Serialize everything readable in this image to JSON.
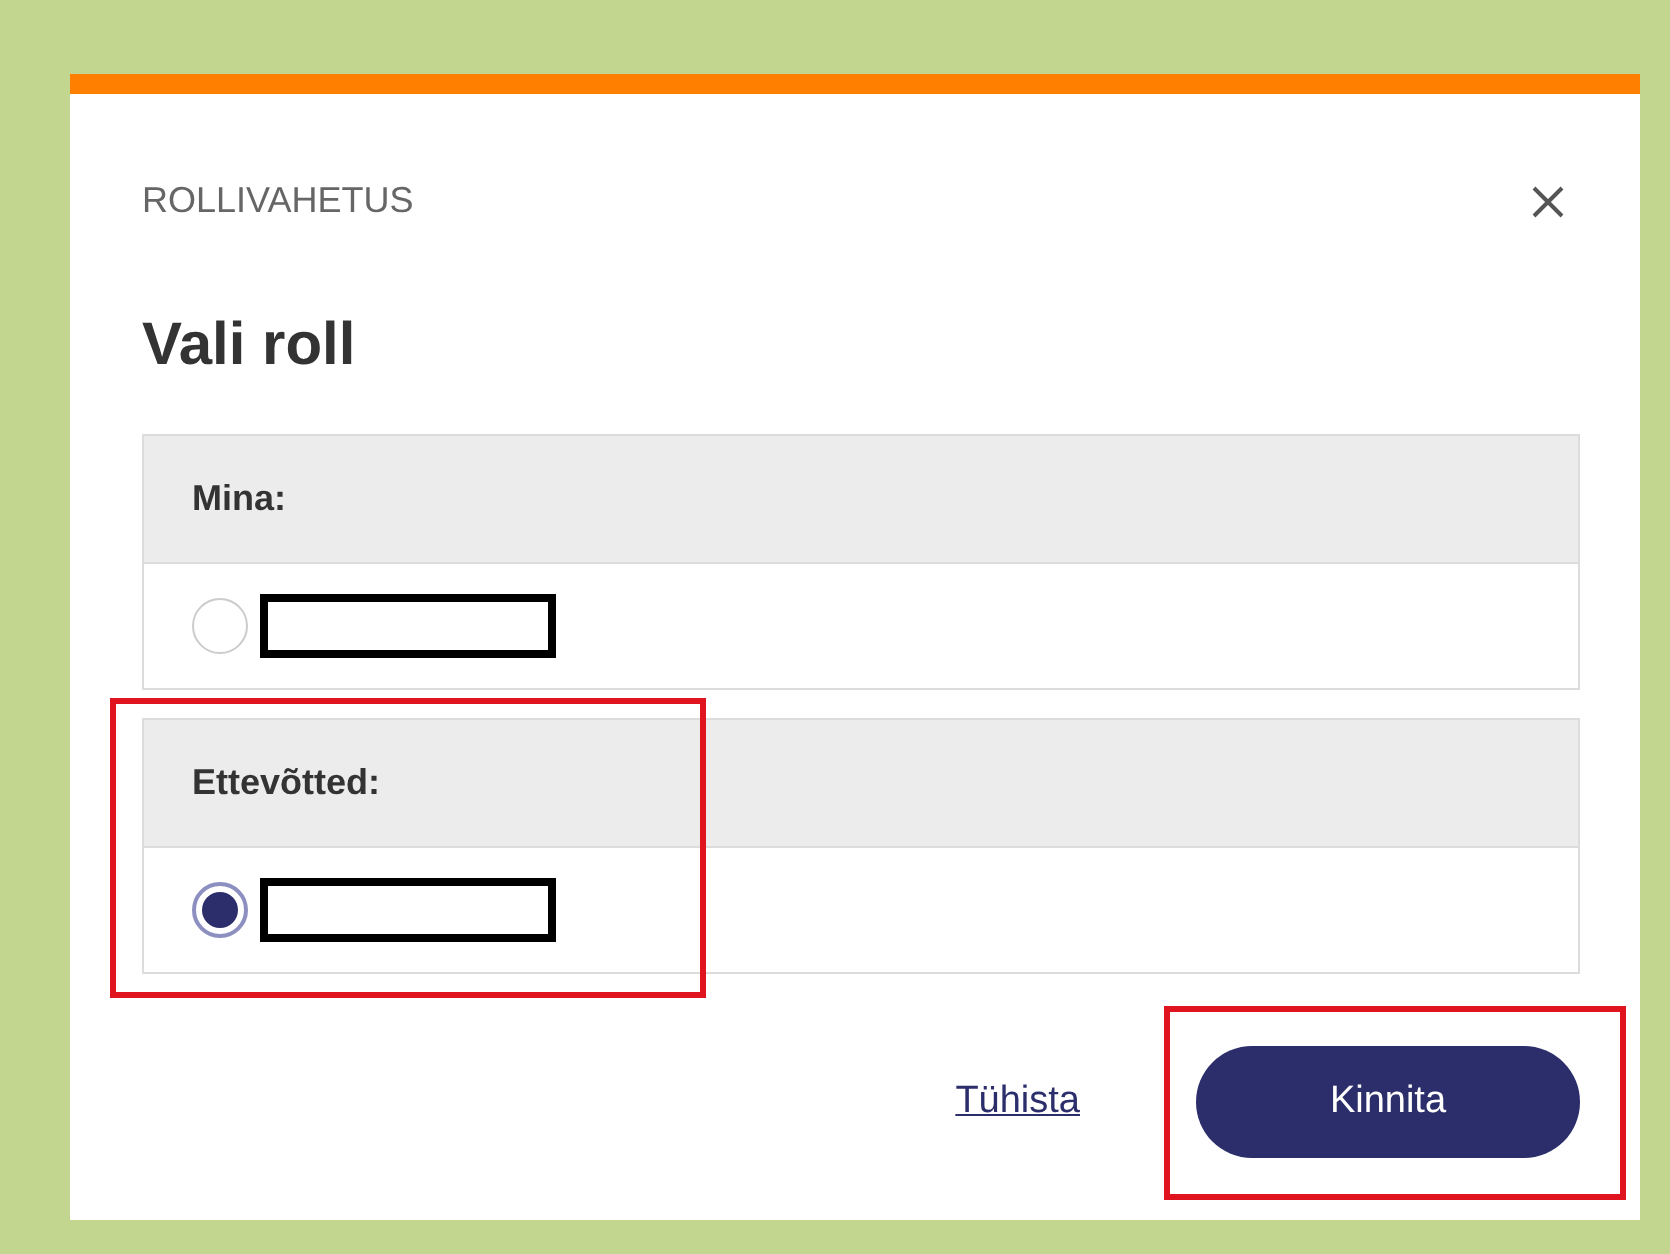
{
  "dialog": {
    "eyebrow": "ROLLIVAHETUS",
    "title": "Vali roll",
    "groups": [
      {
        "label": "Mina:",
        "options": [
          {
            "selected": false
          }
        ],
        "highlighted": false
      },
      {
        "label": "Ettevõtted:",
        "options": [
          {
            "selected": true
          }
        ],
        "highlighted": true
      }
    ],
    "cancel": "Tühista",
    "confirm": {
      "label": "Kinnita",
      "highlighted": true
    }
  }
}
